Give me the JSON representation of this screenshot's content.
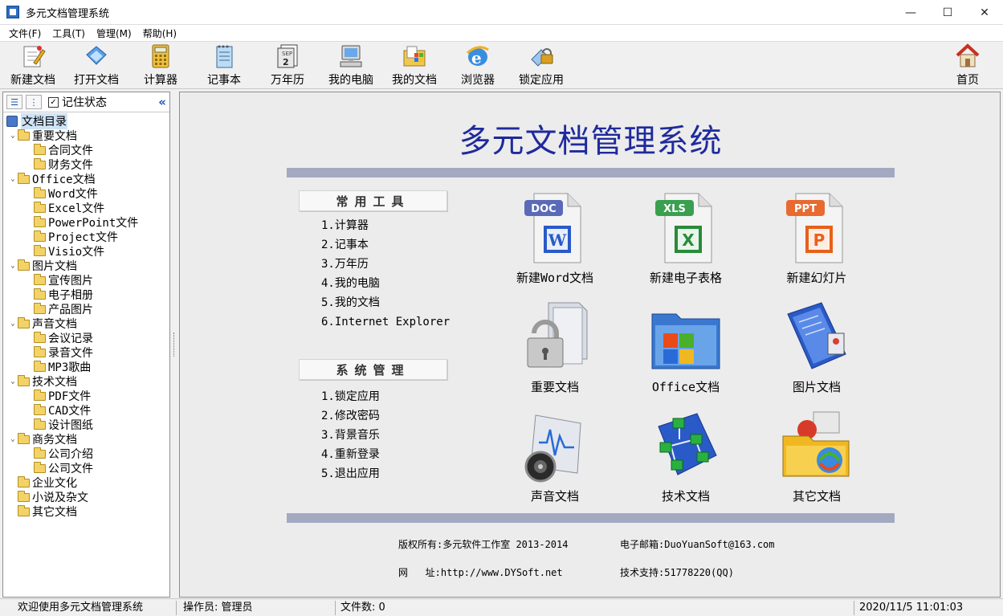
{
  "window": {
    "title": "多元文档管理系统",
    "controls": [
      "—",
      "☐",
      "✕"
    ]
  },
  "menu": [
    "文件(F)",
    "工具(T)",
    "管理(M)",
    "帮助(H)"
  ],
  "toolbar": {
    "items": [
      {
        "label": "新建文档",
        "icon": "new-document-icon"
      },
      {
        "label": "打开文档",
        "icon": "open-document-icon"
      },
      {
        "label": "计算器",
        "icon": "calculator-icon"
      },
      {
        "label": "记事本",
        "icon": "notepad-icon"
      },
      {
        "label": "万年历",
        "icon": "calendar-icon"
      },
      {
        "label": "我的电脑",
        "icon": "computer-icon"
      },
      {
        "label": "我的文档",
        "icon": "my-documents-icon"
      },
      {
        "label": "浏览器",
        "icon": "browser-icon"
      },
      {
        "label": "锁定应用",
        "icon": "lock-app-icon"
      }
    ],
    "home": {
      "label": "首页",
      "icon": "home-icon"
    }
  },
  "sidebar": {
    "remember_label": "记住状态",
    "remember_checked": true,
    "tree": [
      {
        "label": "文档目录",
        "level": 0,
        "root": true
      },
      {
        "label": "重要文档",
        "level": 1,
        "expanded": true
      },
      {
        "label": "合同文件",
        "level": 2
      },
      {
        "label": "财务文件",
        "level": 2
      },
      {
        "label": "Office文档",
        "level": 1,
        "expanded": true
      },
      {
        "label": "Word文件",
        "level": 2
      },
      {
        "label": "Excel文件",
        "level": 2
      },
      {
        "label": "PowerPoint文件",
        "level": 2
      },
      {
        "label": "Project文件",
        "level": 2
      },
      {
        "label": "Visio文件",
        "level": 2
      },
      {
        "label": "图片文档",
        "level": 1,
        "expanded": true
      },
      {
        "label": "宣传图片",
        "level": 2
      },
      {
        "label": "电子相册",
        "level": 2
      },
      {
        "label": "产品图片",
        "level": 2
      },
      {
        "label": "声音文档",
        "level": 1,
        "expanded": true
      },
      {
        "label": "会议记录",
        "level": 2
      },
      {
        "label": "录音文件",
        "level": 2
      },
      {
        "label": "MP3歌曲",
        "level": 2
      },
      {
        "label": "技术文档",
        "level": 1,
        "expanded": true
      },
      {
        "label": "PDF文件",
        "level": 2
      },
      {
        "label": "CAD文件",
        "level": 2
      },
      {
        "label": "设计图纸",
        "level": 2
      },
      {
        "label": "商务文档",
        "level": 1,
        "expanded": true
      },
      {
        "label": "公司介绍",
        "level": 2
      },
      {
        "label": "公司文件",
        "level": 2
      },
      {
        "label": "企业文化",
        "level": 1
      },
      {
        "label": "小说及杂文",
        "level": 1
      },
      {
        "label": "其它文档",
        "level": 1
      }
    ]
  },
  "main": {
    "title": "多元文档管理系统",
    "tools_heading": "常用工具",
    "tools": [
      "1.计算器",
      "2.记事本",
      "3.万年历",
      "4.我的电脑",
      "5.我的文档",
      "6.Internet Explorer"
    ],
    "admin_heading": "系统管理",
    "admin": [
      "1.锁定应用",
      "2.修改密码",
      "3.背景音乐",
      "4.重新登录",
      "5.退出应用"
    ],
    "tiles": [
      {
        "label": "新建Word文档",
        "badge": "DOC",
        "icon": "word-document-icon"
      },
      {
        "label": "新建电子表格",
        "badge": "XLS",
        "icon": "excel-spreadsheet-icon"
      },
      {
        "label": "新建幻灯片",
        "badge": "PPT",
        "icon": "powerpoint-slide-icon"
      },
      {
        "label": "重要文档",
        "icon": "locked-folder-icon"
      },
      {
        "label": "Office文档",
        "icon": "office-folder-icon"
      },
      {
        "label": "图片文档",
        "icon": "picture-book-icon"
      },
      {
        "label": "声音文档",
        "icon": "sound-document-icon"
      },
      {
        "label": "技术文档",
        "icon": "network-diagram-icon"
      },
      {
        "label": "其它文档",
        "icon": "other-folder-icon"
      }
    ],
    "footer": {
      "copyright": "版权所有:多元软件工作室 2013-2014",
      "email": "电子邮箱:DuoYuanSoft@163.com",
      "website": "网   址:http://www.DYSoft.net",
      "support": "技术支持:51778220(QQ)"
    }
  },
  "status": {
    "welcome": "欢迎使用多元文档管理系统",
    "operator": "操作员: 管理员",
    "file_count": "文件数: 0",
    "datetime": "2020/11/5  11:01:03"
  }
}
